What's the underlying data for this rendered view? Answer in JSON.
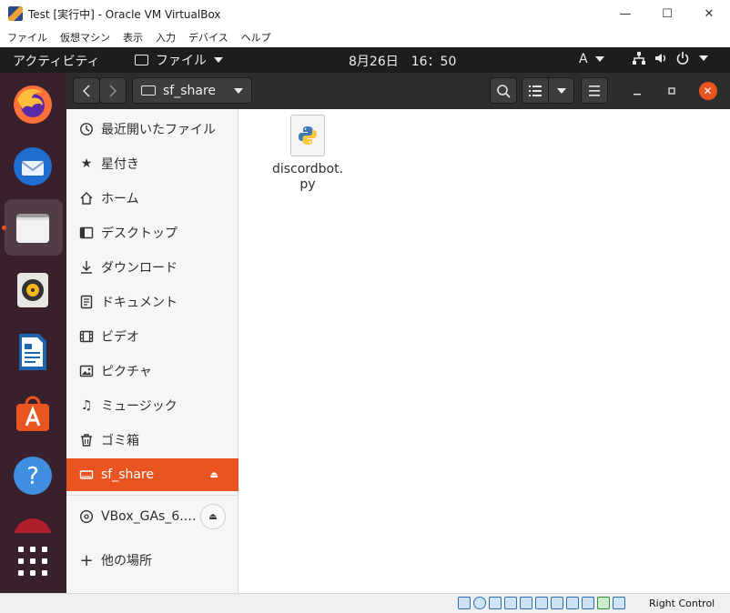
{
  "vbox": {
    "title": "Test [実行中] - Oracle VM VirtualBox",
    "window_buttons": {
      "minimize": "—",
      "maximize": "☐",
      "close": "✕"
    },
    "menu": [
      "ファイル",
      "仮想マシン",
      "表示",
      "入力",
      "デバイス",
      "ヘルプ"
    ],
    "host_key": "Right Control"
  },
  "topbar": {
    "activities": "アクティビティ",
    "app_menu": "ファイル",
    "clock": "8月26日　16：50",
    "input_method": "A"
  },
  "dock": {
    "apps": [
      "firefox-icon",
      "thunderbird-icon",
      "files-icon",
      "rhythmbox-icon",
      "libreoffice-writer-icon",
      "ubuntu-software-icon",
      "help-icon",
      "apps-grid-icon"
    ],
    "running_app": "files-icon"
  },
  "headerbar": {
    "path_label": "sf_share"
  },
  "sidebar": {
    "items": [
      {
        "label": "最近開いたファイル",
        "icon": "recent-icon"
      },
      {
        "label": "星付き",
        "icon": "star-icon"
      },
      {
        "label": "ホーム",
        "icon": "home-icon"
      },
      {
        "label": "デスクトップ",
        "icon": "desktop-icon"
      },
      {
        "label": "ダウンロード",
        "icon": "download-icon"
      },
      {
        "label": "ドキュメント",
        "icon": "documents-icon"
      },
      {
        "label": "ビデオ",
        "icon": "videos-icon"
      },
      {
        "label": "ピクチャ",
        "icon": "pictures-icon"
      },
      {
        "label": "ミュージック",
        "icon": "music-icon"
      },
      {
        "label": "ゴミ箱",
        "icon": "trash-icon"
      },
      {
        "label": "sf_share",
        "icon": "drive-icon",
        "active": true
      },
      {
        "label": "VBox_GAs_6.…",
        "icon": "disc-icon"
      },
      {
        "label": "他の場所",
        "icon": "plus-icon"
      }
    ]
  },
  "files": [
    {
      "name_line1": "discordbot.",
      "name_line2": "py",
      "icon": "python-file-icon"
    }
  ],
  "colors": {
    "accent": "#e95420",
    "dock_bg": "#38202c",
    "topbar_bg": "#1d1d1d",
    "headerbar_bg": "#2d2d2d"
  }
}
